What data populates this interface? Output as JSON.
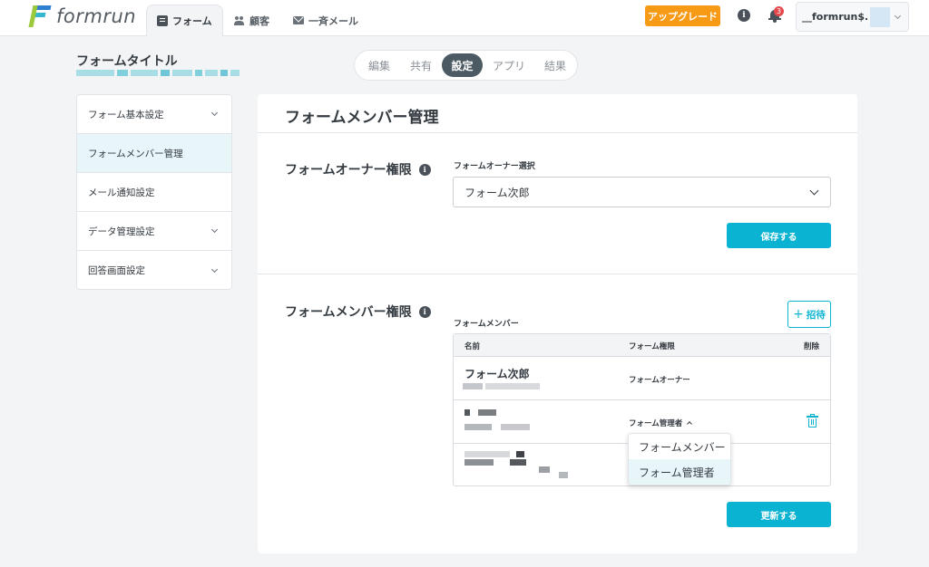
{
  "header": {
    "logo_text": "formrun",
    "nav": [
      {
        "label": "フォーム",
        "icon": "document-icon",
        "active": true
      },
      {
        "label": "顧客",
        "icon": "people-icon",
        "active": false
      },
      {
        "label": "一斉メール",
        "icon": "mail-icon",
        "active": false
      }
    ],
    "upgrade_label": "アップグレード",
    "info_icon_glyph": "i",
    "notification_count": "3",
    "account_name": "__formrun$..."
  },
  "form": {
    "title": "フォームタイトル"
  },
  "segments": [
    "編集",
    "共有",
    "設定",
    "アプリ",
    "結果"
  ],
  "active_segment": "設定",
  "sidebar": {
    "items": [
      {
        "label": "フォーム基本設定",
        "expandable": true
      },
      {
        "label": "フォームメンバー管理",
        "expandable": false,
        "active": true
      },
      {
        "label": "メール通知設定",
        "expandable": false
      },
      {
        "label": "データ管理設定",
        "expandable": true
      },
      {
        "label": "回答画面設定",
        "expandable": true
      }
    ]
  },
  "main": {
    "title": "フォームメンバー管理",
    "owner_section": {
      "title": "フォームオーナー権限",
      "field_label": "フォームオーナー選択",
      "selected_owner": "フォーム次郎",
      "save_label": "保存する"
    },
    "member_section": {
      "title": "フォームメンバー権限",
      "field_label": "フォームメンバー",
      "invite_label": "招待",
      "table_headers": {
        "name": "名前",
        "role": "フォーム権限",
        "delete": "削除"
      },
      "rows": [
        {
          "name": "フォーム次郎",
          "role": "フォームオーナー"
        },
        {
          "name": "",
          "role": "フォーム管理者"
        },
        {
          "name": "",
          "role": ""
        }
      ],
      "update_label": "更新する"
    }
  },
  "role_dropdown": {
    "options": [
      "フォームメンバー",
      "フォーム管理者"
    ],
    "highlighted": "フォーム管理者"
  },
  "colors": {
    "accent": "#0bb3d3",
    "upgrade": "#f79a16",
    "active_segment": "#4b5a63",
    "sidebar_active": "#e8f6f9",
    "badge": "#e5484d"
  }
}
